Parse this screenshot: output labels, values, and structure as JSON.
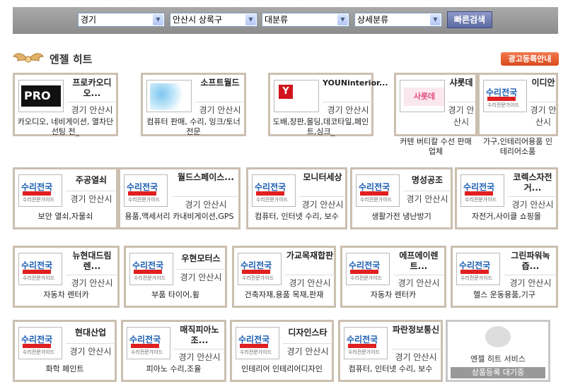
{
  "search": {
    "region": "경기",
    "city": "안산시 상록구",
    "category": "대분류",
    "subcategory": "상세분류",
    "button": "빠른검색"
  },
  "section": {
    "title": "엔젤 히트",
    "ad_button": "광고등록안내"
  },
  "cards": [
    {
      "title": "프로카오디오...",
      "location": "경기 안산시",
      "desc": "카오디오, 네비게이션, 열차단 선팅 전_",
      "logo": "pro-logo"
    },
    {
      "title": "소프트월드",
      "location": "경기 안산시",
      "desc": "컴퓨터 판매, 수리, 잉크/토너 전문",
      "logo": "blur-logo"
    },
    {
      "title": "YOUNinterior...",
      "location": "경기 안산시",
      "desc": "도배,장판,몰딩,데코타일,페인트,싱크_",
      "logo": "you-logo"
    },
    {
      "title": "샤롯데",
      "location": "경기 안산시",
      "desc": "커텐 버티칼 수선 판매 업체",
      "logo": "sharotte-logo",
      "sharotte_text": "사롯데"
    },
    {
      "title": "이디안",
      "location": "경기 안산시",
      "desc": "가구,인테리어용품 인테리어소품",
      "logo": "suri-logo"
    },
    {
      "title": "주공열쇠",
      "location": "경기 안산시",
      "desc": "보안 열쇠,자물쇠",
      "logo": "suri-logo"
    },
    {
      "title": "월드스페이스...",
      "location": "경기 안산시",
      "desc": "용품,액세서리 카내비게이션,GPS",
      "logo": "suri-logo"
    },
    {
      "title": "모니터세상",
      "location": "경기 안산시",
      "desc": "컴퓨터, 인터넷 수리, 보수",
      "logo": "suri-logo"
    },
    {
      "title": "명성공조",
      "location": "경기 안산시",
      "desc": "생활가전 냉난방기",
      "logo": "suri-logo"
    },
    {
      "title": "코렉스자전거...",
      "location": "경기 안산시",
      "desc": "자전거,사이클 쇼핑몰",
      "logo": "suri-logo"
    },
    {
      "title": "뉴현대드림렌...",
      "location": "경기 안산시",
      "desc": "자동차 렌터카",
      "logo": "suri-logo"
    },
    {
      "title": "우현모터스",
      "location": "경기 안산시",
      "desc": "부품 타이어,휠",
      "logo": "suri-logo"
    },
    {
      "title": "가교목재합판",
      "location": "경기 안산시",
      "desc": "건축자재,용품 목재,판재",
      "logo": "suri-logo"
    },
    {
      "title": "에프에이렌트...",
      "location": "경기 안산시",
      "desc": "자동차 렌터카",
      "logo": "suri-logo"
    },
    {
      "title": "그린파워녹즙...",
      "location": "경기 안산시",
      "desc": "헬스 운동용품,기구",
      "logo": "suri-logo"
    },
    {
      "title": "현대산업",
      "location": "경기 안산시",
      "desc": "화학 페인트",
      "logo": "suri-logo"
    },
    {
      "title": "매직피아노조...",
      "location": "경기 안산시",
      "desc": "피아노 수리,조율",
      "logo": "suri-logo"
    },
    {
      "title": "디자인스타",
      "location": "경기 안산시",
      "desc": "인테리어 인테리어디자인",
      "logo": "suri-logo"
    },
    {
      "title": "파란정보통신",
      "location": "경기 안산시",
      "desc": "컴퓨터, 인터넷 수리, 보수",
      "logo": "suri-logo"
    }
  ],
  "logos": {
    "suri_top": "수리전국",
    "suri_bottom": "수리전문가이드",
    "pro": "PRO"
  },
  "service_card": {
    "text": "엔젤 히트 서비스",
    "status": "상품등록 대기중"
  }
}
